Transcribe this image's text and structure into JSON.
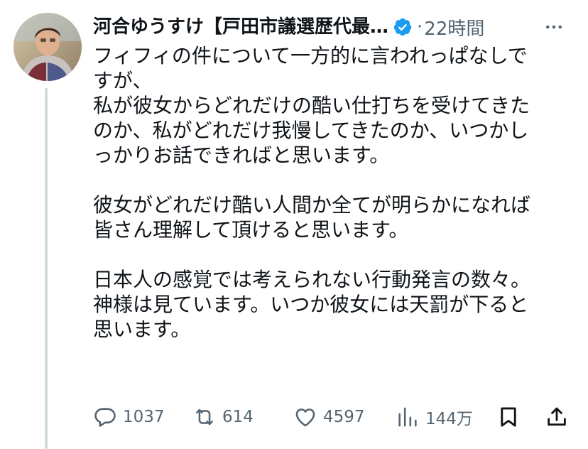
{
  "post": {
    "author_name": "河合ゆうすけ【戸田市議選歴代最…",
    "separator": "·",
    "timestamp": "22時間",
    "body": {
      "line1": "フィフィの件について一方的に言われっぱなしで",
      "line2": "すが、",
      "line3": "私が彼女からどれだけの酷い仕打ちを受けてきた",
      "line4": "のか、私がどれだけ我慢してきたのか、いつかし",
      "line5": "っかりお話できればと思います。",
      "line6": "彼女がどれだけ酷い人間か全てが明らかになれば",
      "line7": "皆さん理解して頂けると思います。",
      "line8": "日本人の感覚では考えられない行動発言の数々。",
      "line9": "神様は見ています。いつか彼女には天罰が下ると",
      "line10": "思います。"
    },
    "actions": {
      "replies": "1037",
      "reposts": "614",
      "likes": "4597",
      "views": "144万"
    }
  },
  "icons": {
    "verified": "verified-badge-icon",
    "more": "more-dots-icon",
    "reply": "reply-bubble-icon",
    "repost": "repost-arrows-icon",
    "like": "heart-icon",
    "views": "views-bars-icon",
    "bookmark": "bookmark-icon",
    "share": "share-upload-icon"
  },
  "colors": {
    "text": "#0f1419",
    "secondary": "#536471",
    "verified": "#1d9bf0",
    "thread_line": "#cfd9de"
  }
}
